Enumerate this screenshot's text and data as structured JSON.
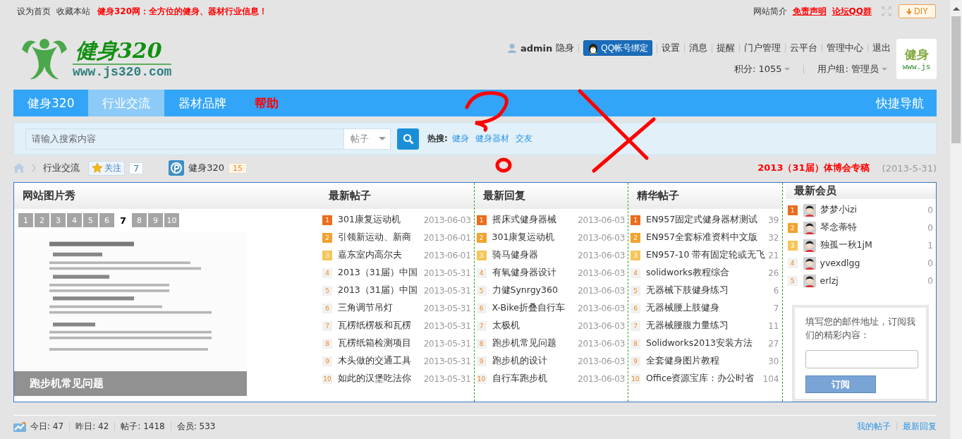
{
  "top_bar": {
    "left_links": [
      "设为首页",
      "收藏本站"
    ],
    "slogan": "健身320网：全方位的健身、器材行业信息！",
    "right_links": [
      {
        "label": "网站简介",
        "kind": "plain"
      },
      {
        "label": "免责声明",
        "kind": "alert"
      },
      {
        "label": "论坛QQ群",
        "kind": "alert"
      }
    ],
    "diy_button": "DIY"
  },
  "logo": {
    "title": "健身320",
    "url": "www.js320.com"
  },
  "user": {
    "name": "admin",
    "status": "隐身",
    "qq_button": "QQ帐号绑定",
    "links": [
      "设置",
      "消息",
      "提醒",
      "门户管理",
      "云平台",
      "管理中心",
      "退出"
    ],
    "points": "积分: 1055",
    "group": "用户组: 管理员",
    "avatar_lines": [
      "健身",
      "www.js"
    ]
  },
  "nav": {
    "items": [
      {
        "label": "健身320",
        "selected": false,
        "kind": "normal"
      },
      {
        "label": "行业交流",
        "selected": true,
        "kind": "normal"
      },
      {
        "label": "器材品牌",
        "selected": false,
        "kind": "normal"
      },
      {
        "label": "帮助",
        "selected": false,
        "kind": "alert"
      }
    ],
    "quick_nav": "快捷导航"
  },
  "search": {
    "placeholder": "请输入搜索内容",
    "scope": "帖子",
    "hot_label": "热搜:",
    "hot": [
      "健身",
      "健身器材",
      "交友"
    ]
  },
  "breadcrumb": {
    "current": "行业交流",
    "follow": "关注",
    "follow_count": "7",
    "forum": "健身320",
    "forum_count": "15",
    "feature": "2013（31届）体博会专稿",
    "feature_date": "(2013-5-31)"
  },
  "gallery": {
    "title": "网站图片秀",
    "pages": [
      {
        "label": "1",
        "selected": false
      },
      {
        "label": "2",
        "selected": false
      },
      {
        "label": "3",
        "selected": false
      },
      {
        "label": "4",
        "selected": false
      },
      {
        "label": "5",
        "selected": false
      },
      {
        "label": "6",
        "selected": false
      },
      {
        "label": "7",
        "selected": true
      },
      {
        "label": "8",
        "selected": false
      },
      {
        "label": "9",
        "selected": false
      },
      {
        "label": "10",
        "selected": false
      }
    ],
    "caption": "跑步机常见问题"
  },
  "latest_posts": {
    "title": "最新帖子",
    "items": [
      {
        "rank": "1",
        "title": "301康复运动机",
        "meta": "2013-06-03"
      },
      {
        "rank": "2",
        "title": "引领新运动、新商",
        "meta": "2013-06-01"
      },
      {
        "rank": "3",
        "title": "嘉东室内高尔夫",
        "meta": "2013-06-01"
      },
      {
        "rank": "4",
        "title": "2013（31届）中国",
        "meta": "2013-05-31"
      },
      {
        "rank": "5",
        "title": "2013（31届）中国",
        "meta": "2013-05-31"
      },
      {
        "rank": "6",
        "title": "三角调节吊灯",
        "meta": "2013-05-31"
      },
      {
        "rank": "7",
        "title": "瓦楞纸楞板和瓦楞",
        "meta": "2013-05-31"
      },
      {
        "rank": "8",
        "title": "瓦楞纸箱检测项目",
        "meta": "2013-05-31"
      },
      {
        "rank": "9",
        "title": "木头做的交通工具",
        "meta": "2013-05-31"
      },
      {
        "rank": "10",
        "title": "如此的汉堡吃法你",
        "meta": "2013-05-31"
      }
    ]
  },
  "latest_replies": {
    "title": "最新回复",
    "items": [
      {
        "rank": "1",
        "title": "摇床式健身器械",
        "meta": "2013-06-03"
      },
      {
        "rank": "2",
        "title": "301康复运动机",
        "meta": "2013-06-03"
      },
      {
        "rank": "3",
        "title": "骑马健身器",
        "meta": "2013-06-03"
      },
      {
        "rank": "4",
        "title": "有氧健身器设计",
        "meta": "2013-06-03"
      },
      {
        "rank": "5",
        "title": "力健Synrgy360",
        "meta": "2013-06-03"
      },
      {
        "rank": "6",
        "title": "X-Bike折叠自行车",
        "meta": "2013-06-03"
      },
      {
        "rank": "7",
        "title": "太极机",
        "meta": "2013-06-03"
      },
      {
        "rank": "8",
        "title": "跑步机常见问题",
        "meta": "2013-06-03"
      },
      {
        "rank": "9",
        "title": "跑步机的设计",
        "meta": "2013-06-03"
      },
      {
        "rank": "10",
        "title": "自行车跑步机",
        "meta": "2013-06-03"
      }
    ]
  },
  "featured_posts": {
    "title": "精华帖子",
    "items": [
      {
        "rank": "1",
        "title": "EN957固定式健身器材测试",
        "meta": "39"
      },
      {
        "rank": "2",
        "title": "EN957全套标准资料中文版",
        "meta": "32"
      },
      {
        "rank": "3",
        "title": "EN957-10 带有固定轮或无飞",
        "meta": "21"
      },
      {
        "rank": "4",
        "title": "solidworks教程综合",
        "meta": "26"
      },
      {
        "rank": "5",
        "title": "无器械下肢健身练习",
        "meta": "6"
      },
      {
        "rank": "6",
        "title": "无器械腰上肢健身",
        "meta": "7"
      },
      {
        "rank": "7",
        "title": "无器械腰腹力量练习",
        "meta": "11"
      },
      {
        "rank": "8",
        "title": "Solidworks2013安装方法",
        "meta": "27"
      },
      {
        "rank": "9",
        "title": "全套健身图片教程",
        "meta": "30"
      },
      {
        "rank": "10",
        "title": "Office资源宝库：办公时省",
        "meta": "104"
      }
    ]
  },
  "new_members": {
    "title": "最新会员",
    "items": [
      {
        "rank": "1",
        "name": "梦梦小izi",
        "count": "0"
      },
      {
        "rank": "2",
        "name": "琴念蒂特",
        "count": "0"
      },
      {
        "rank": "3",
        "name": "独孤一秋1jM",
        "count": "1"
      },
      {
        "rank": "4",
        "name": "yvexdlgg",
        "count": "0"
      },
      {
        "rank": "5",
        "name": "erlzj",
        "count": "0"
      }
    ],
    "subscribe": {
      "text": "填写您的邮件地址，订阅我们的精彩内容：",
      "button": "订阅"
    }
  },
  "stats": {
    "items": [
      "今日: 47",
      "昨日: 42",
      "帖子: 1418",
      "会员: 533"
    ],
    "links": [
      "我的帖子",
      "最新回复"
    ]
  }
}
